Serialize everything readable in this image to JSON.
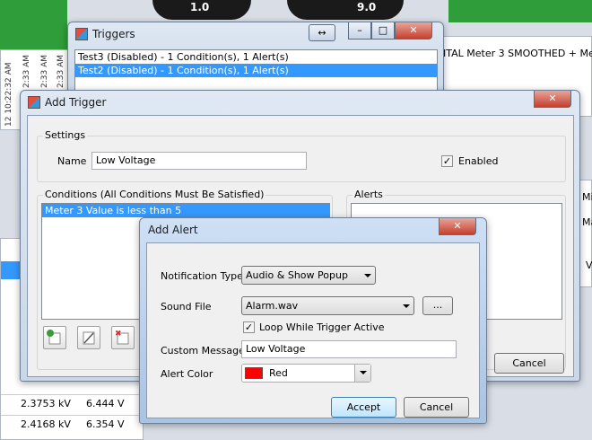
{
  "background": {
    "gauge_left_value": "1.0",
    "gauge_right_value": "9.0",
    "meter_title": "ITAL Meter 3 SMOOTHED + Me",
    "timestamps": [
      "12 10:22:32 AM",
      "2:33 AM",
      "2:33 AM",
      "2:33 AM"
    ],
    "right_labels": [
      "Mi",
      "Ma",
      "V"
    ],
    "table_rows": [
      {
        "kv": "2.3753 kV",
        "v": "6.444 V"
      },
      {
        "kv": "2.4168 kV",
        "v": "6.354 V"
      }
    ]
  },
  "triggers_window": {
    "title": "Triggers",
    "items": [
      "Test3 (Disabled) - 1 Condition(s), 1 Alert(s)",
      "Test2 (Disabled) - 1 Condition(s), 1 Alert(s)"
    ],
    "selected_index": 1
  },
  "add_trigger": {
    "title": "Add Trigger",
    "settings_label": "Settings",
    "name_label": "Name",
    "name_value": "Low Voltage",
    "enabled_label": "Enabled",
    "enabled_checked": true,
    "conditions_label": "Conditions (All Conditions Must Be Satisfied)",
    "conditions": [
      "Meter 3 Value is less than 5"
    ],
    "alerts_label": "Alerts",
    "cancel_label": "Cancel"
  },
  "add_alert": {
    "title": "Add Alert",
    "notification_type_label": "Notification Type",
    "notification_type_value": "Audio & Show Popup",
    "sound_file_label": "Sound File",
    "sound_file_value": "Alarm.wav",
    "browse_label": "...",
    "loop_label": "Loop While Trigger Active",
    "loop_checked": true,
    "custom_message_label": "Custom Message",
    "custom_message_value": "Low Voltage",
    "alert_color_label": "Alert Color",
    "alert_color_value": "Red",
    "alert_color_hex": "#ff0000",
    "accept_label": "Accept",
    "cancel_label": "Cancel"
  }
}
